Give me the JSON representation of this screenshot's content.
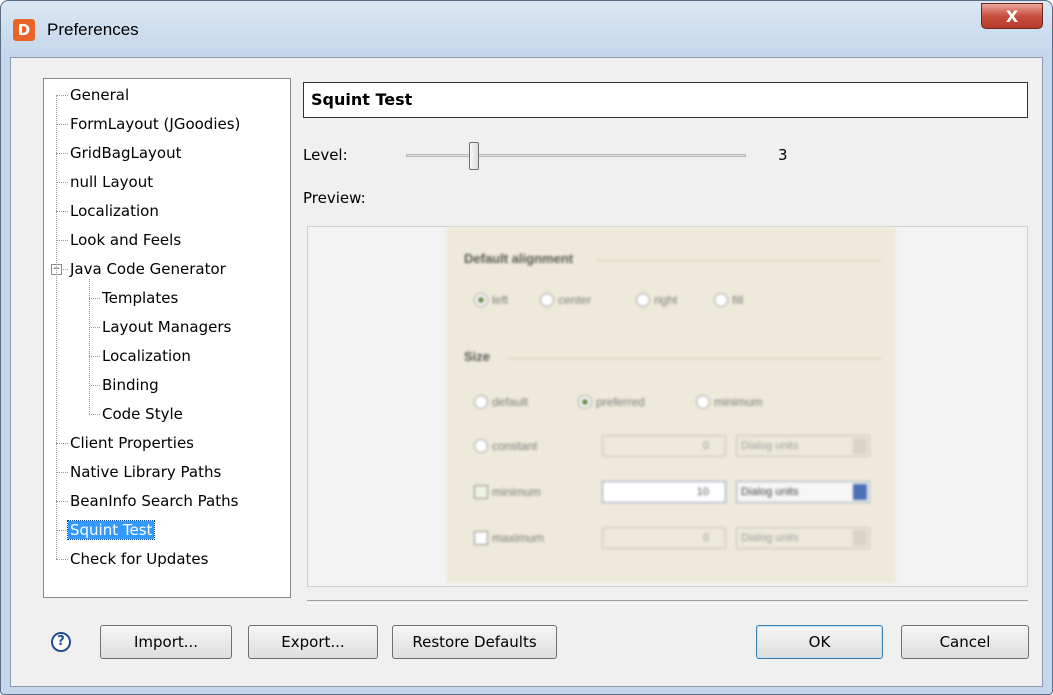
{
  "window": {
    "title": "Preferences",
    "app_icon_letter": "D",
    "close_label": "X"
  },
  "tree": {
    "items": [
      {
        "label": "General",
        "level": 0
      },
      {
        "label": "FormLayout (JGoodies)",
        "level": 0
      },
      {
        "label": "GridBagLayout",
        "level": 0
      },
      {
        "label": "null Layout",
        "level": 0
      },
      {
        "label": "Localization",
        "level": 0
      },
      {
        "label": "Look and Feels",
        "level": 0
      },
      {
        "label": "Java Code Generator",
        "level": 0,
        "expanded": true
      },
      {
        "label": "Templates",
        "level": 1
      },
      {
        "label": "Layout Managers",
        "level": 1
      },
      {
        "label": "Localization",
        "level": 1
      },
      {
        "label": "Binding",
        "level": 1
      },
      {
        "label": "Code Style",
        "level": 1
      },
      {
        "label": "Client Properties",
        "level": 0
      },
      {
        "label": "Native Library Paths",
        "level": 0
      },
      {
        "label": "BeanInfo Search Paths",
        "level": 0
      },
      {
        "label": "Squint Test",
        "level": 0,
        "selected": true
      },
      {
        "label": "Check for Updates",
        "level": 0
      }
    ]
  },
  "panel": {
    "title": "Squint Test",
    "level_label": "Level:",
    "level_value": "3",
    "level_slider_fraction": 0.2,
    "preview_label": "Preview:"
  },
  "preview_content": {
    "alignment_header": "Default alignment",
    "alignment_options": [
      "left",
      "center",
      "right",
      "fill"
    ],
    "size_header": "Size",
    "size_options": [
      "default",
      "preferred",
      "minimum"
    ],
    "constant_label": "constant",
    "constant_value": "0",
    "minimum_label": "minimum",
    "minimum_value": "10",
    "maximum_label": "maximum",
    "maximum_value": "0",
    "units": "Dialog units"
  },
  "buttons": {
    "help_label": "?",
    "import_label": "Import...",
    "export_label": "Export...",
    "restore_label": "Restore Defaults",
    "ok_label": "OK",
    "cancel_label": "Cancel"
  }
}
